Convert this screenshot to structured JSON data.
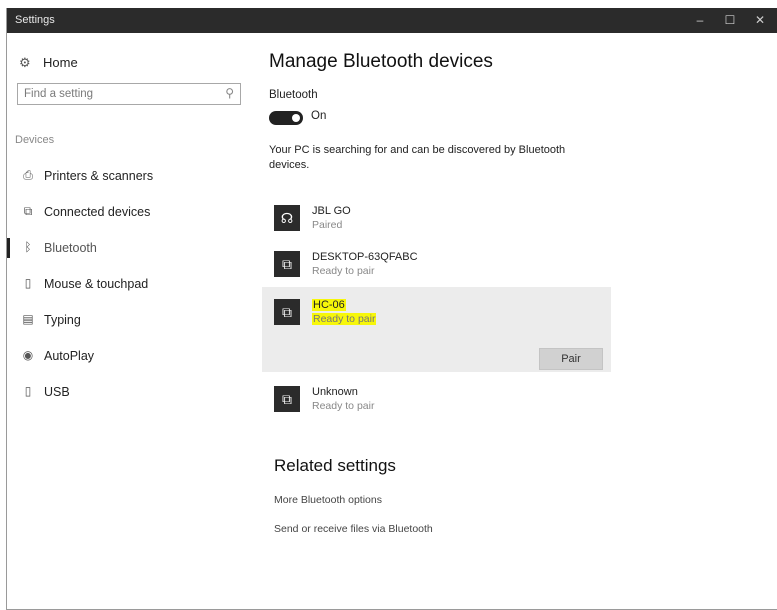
{
  "window": {
    "title": "Settings",
    "controls": {
      "minimize": "–",
      "maximize": "☐",
      "close": "✕"
    }
  },
  "sidebar": {
    "home": {
      "label": "Home",
      "icon": "gear-icon"
    },
    "search": {
      "placeholder": "Find a setting"
    },
    "group_label": "Devices",
    "items": [
      {
        "label": "Printers & scanners",
        "icon": "printer-icon",
        "active": false
      },
      {
        "label": "Connected devices",
        "icon": "devices-icon",
        "active": false
      },
      {
        "label": "Bluetooth",
        "icon": "bluetooth-icon",
        "active": true
      },
      {
        "label": "Mouse & touchpad",
        "icon": "mouse-icon",
        "active": false
      },
      {
        "label": "Typing",
        "icon": "keyboard-icon",
        "active": false
      },
      {
        "label": "AutoPlay",
        "icon": "autoplay-icon",
        "active": false
      },
      {
        "label": "USB",
        "icon": "usb-icon",
        "active": false
      }
    ]
  },
  "main": {
    "title": "Manage Bluetooth devices",
    "bluetooth_label": "Bluetooth",
    "toggle_state": "On",
    "toggle_on": true,
    "status_text": "Your PC is searching for and can be discovered by Bluetooth devices.",
    "devices": [
      {
        "name": "JBL GO",
        "state": "Paired",
        "icon": "headphones-icon"
      },
      {
        "name": "DESKTOP-63QFABC",
        "state": "Ready to pair",
        "icon": "computer-icon"
      },
      {
        "name": "HC-06",
        "state": "Ready to pair",
        "icon": "computer-icon",
        "selected": true,
        "button": "Pair"
      },
      {
        "name": "Unknown",
        "state": "Ready to pair",
        "icon": "computer-icon"
      }
    ],
    "related_title": "Related settings",
    "related_links": [
      "More Bluetooth options",
      "Send or receive files via Bluetooth"
    ]
  },
  "colors": {
    "titlebar": "#2b2b2b",
    "highlight": "#f7f70a",
    "selected_bg": "#ececec",
    "button_bg": "#d1d1d1"
  }
}
